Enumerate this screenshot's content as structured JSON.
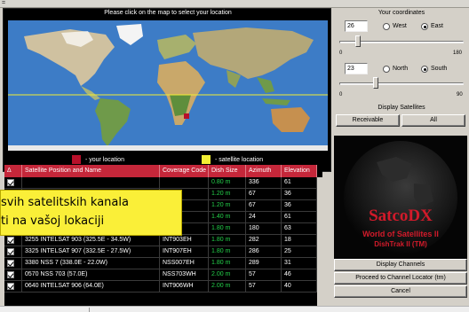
{
  "window": {
    "system_menu_glyph": "="
  },
  "map": {
    "caption": "Please click on the map to select your location",
    "legend": {
      "your_location": "- your location",
      "satellite_location": "- satellite location"
    },
    "colors": {
      "your_location": "#b7102a",
      "satellite_location": "#f2ee33",
      "ocean": "#3d7cc6"
    }
  },
  "coordinates": {
    "title": "Your coordinates",
    "longitude": {
      "value": "26",
      "west_label": "West",
      "east_label": "East",
      "selected": "East",
      "slider_value": 26,
      "min_label": "0",
      "max_label": "180"
    },
    "latitude": {
      "value": "23",
      "north_label": "North",
      "south_label": "South",
      "selected": "South",
      "slider_value": 23,
      "min_label": "0",
      "max_label": "90"
    }
  },
  "display_satellites": {
    "title": "Display Satellites",
    "receivable_label": "Receivable",
    "all_label": "All"
  },
  "logo": {
    "title": "SatcoDX",
    "subtitle": "World of Satellites II",
    "product": "DishTrak II (TM)"
  },
  "actions": {
    "display_channels": "Display Channels",
    "proceed": "Proceed to Channel Locator (tm)",
    "cancel": "Cancel"
  },
  "table": {
    "columns": [
      "Δ",
      "Satellite Position and Name",
      "Coverage Code",
      "Dish Size",
      "Azimuth",
      "Elevation"
    ],
    "rows": [
      [
        "",
        "",
        "",
        "0.80 m",
        "336",
        "61"
      ],
      [
        "",
        "",
        "",
        "1.20 m",
        "67",
        "36"
      ],
      [
        "",
        "",
        "",
        "1.20 m",
        "67",
        "36"
      ],
      [
        "",
        "",
        "",
        "1.40 m",
        "24",
        "61"
      ],
      [
        "",
        "",
        "",
        "1.80 m",
        "180",
        "63"
      ],
      [
        "",
        "3255 INTELSAT 903 (325.5E - 34.5W)",
        "INT903EH",
        "1.80 m",
        "282",
        "18"
      ],
      [
        "",
        "3325 INTELSAT 907 (332.5E - 27.5W)",
        "INT907EH",
        "1.80 m",
        "286",
        "25"
      ],
      [
        "",
        "3380 NSS 7 (338.0E - 22.0W)",
        "NSS007EH",
        "1.80 m",
        "289",
        "31"
      ],
      [
        "",
        "0570 NSS 703 (57.0E)",
        "NSS703WH",
        "2.00 m",
        "57",
        "46"
      ],
      [
        "",
        "0640 INTELSAT 906 (64.0E)",
        "INT906WH",
        "2.00 m",
        "57",
        "40"
      ]
    ]
  },
  "caption_overlay": {
    "line1": "svih satelitskih kanala",
    "line2": "ti na vašoj lokaciji"
  }
}
